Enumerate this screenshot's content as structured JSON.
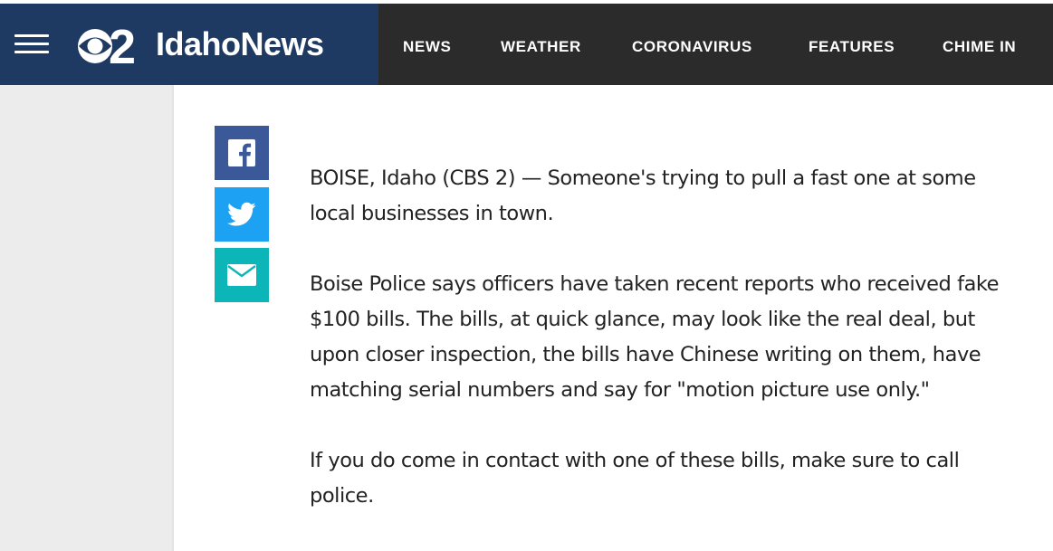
{
  "header": {
    "logo": {
      "channel_mark": "2",
      "site_name": "IdahoNews",
      "brand_color": "#1e3a63"
    },
    "nav_background": "#2b2b2b",
    "nav": [
      {
        "label": "NEWS"
      },
      {
        "label": "WEATHER"
      },
      {
        "label": "CORONAVIRUS"
      },
      {
        "label": "FEATURES"
      },
      {
        "label": "CHIME IN"
      }
    ],
    "menu_icon": "hamburger-menu-icon"
  },
  "share": {
    "buttons": [
      {
        "name": "facebook",
        "icon": "facebook-icon",
        "color": "#3b5998"
      },
      {
        "name": "twitter",
        "icon": "twitter-icon",
        "color": "#1da1f2"
      },
      {
        "name": "email",
        "icon": "email-icon",
        "color": "#0bb5b8"
      }
    ]
  },
  "article": {
    "paragraphs": [
      "BOISE, Idaho (CBS 2) — Someone's trying to pull a fast one at some local businesses in town.",
      "Boise Police says officers have taken recent reports who received fake $100 bills. The bills, at quick glance, may look like the real deal, but upon closer inspection, the bills have Chinese writing on them, have matching serial numbers and say for \"motion picture use only.\"",
      "If you do come in contact with one of these bills, make sure to call police."
    ]
  }
}
